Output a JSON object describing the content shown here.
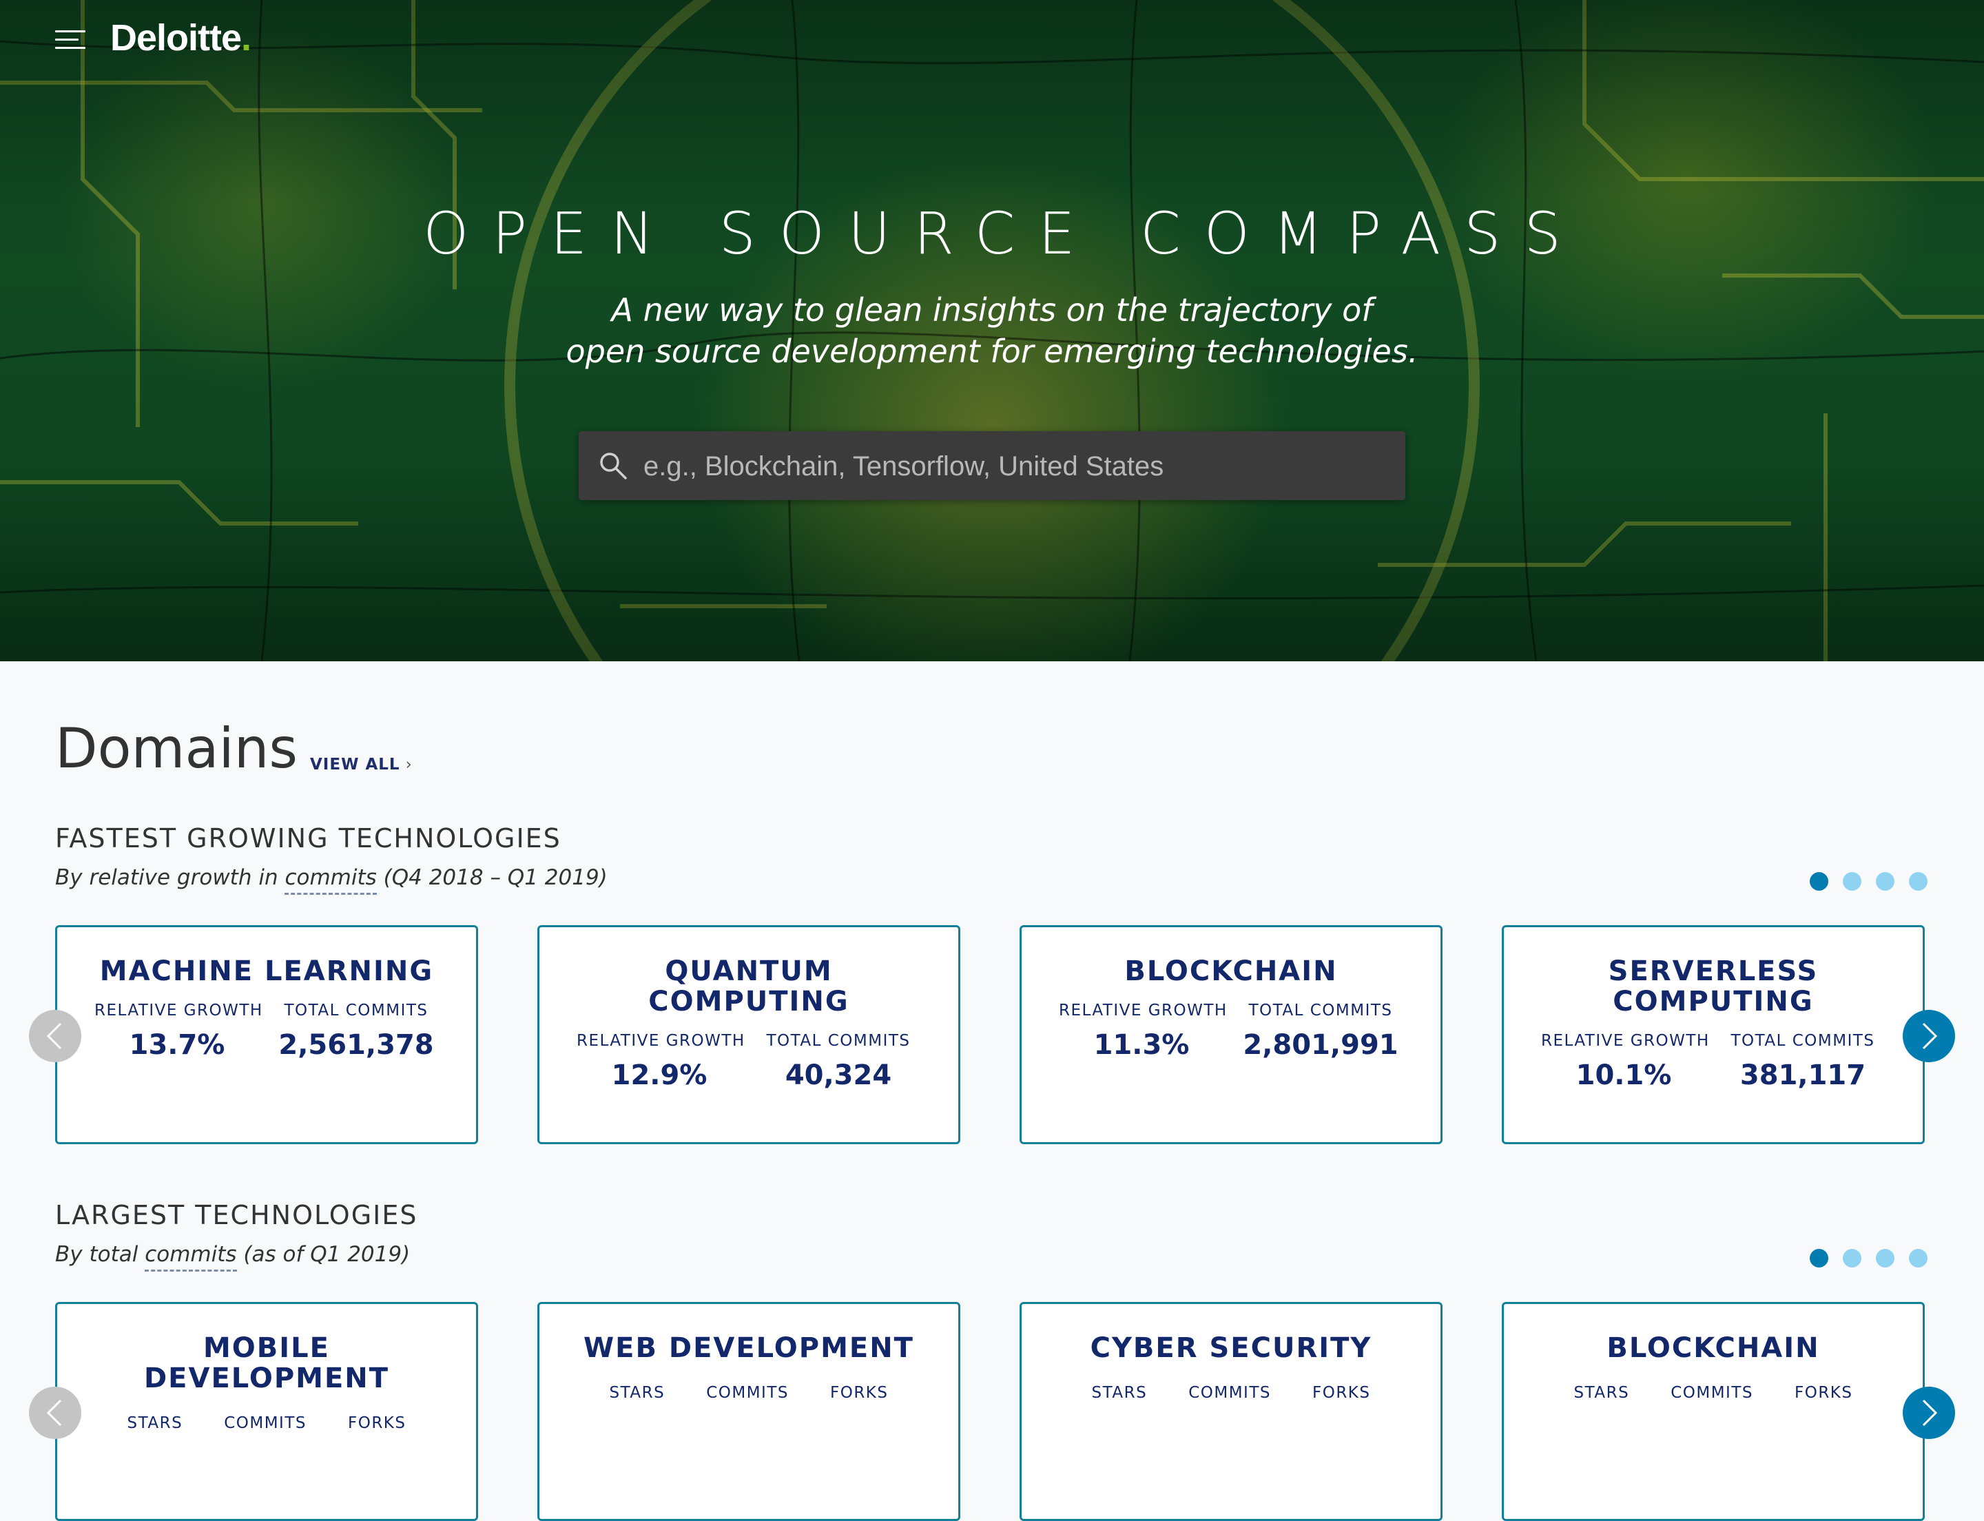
{
  "header": {
    "logo_text": "Deloitte",
    "logo_dot": ".",
    "menu_icon": "hamburger-menu-icon"
  },
  "hero": {
    "title": "OPEN SOURCE COMPASS",
    "subtitle_line1": "A new way to glean insights on the trajectory of",
    "subtitle_line2": "open source development for emerging technologies.",
    "search_placeholder": "e.g., Blockchain, Tensorflow, United States",
    "search_icon": "search-icon"
  },
  "domains": {
    "title": "Domains",
    "view_all": "VIEW ALL",
    "view_all_chevron": "›"
  },
  "fastest": {
    "title": "FASTEST GROWING TECHNOLOGIES",
    "subtitle_before": "By relative growth in ",
    "subtitle_link": "commits",
    "subtitle_after": " (Q4 2018 – Q1 2019)",
    "pages": 4,
    "active_page": 1,
    "stat_label_1": "RELATIVE GROWTH",
    "stat_label_2": "TOTAL COMMITS",
    "cards": [
      {
        "title": "MACHINE LEARNING",
        "growth": "13.7%",
        "commits": "2,561,378"
      },
      {
        "title": "QUANTUM COMPUTING",
        "growth": "12.9%",
        "commits": "40,324"
      },
      {
        "title": "BLOCKCHAIN",
        "growth": "11.3%",
        "commits": "2,801,991"
      },
      {
        "title": "SERVERLESS COMPUTING",
        "growth": "10.1%",
        "commits": "381,117"
      }
    ]
  },
  "largest": {
    "title": "LARGEST TECHNOLOGIES",
    "subtitle_before": "By total ",
    "subtitle_link": "commits",
    "subtitle_after": " (as of Q1 2019)",
    "pages": 4,
    "active_page": 1,
    "stat_label_1": "STARS",
    "stat_label_2": "COMMITS",
    "stat_label_3": "FORKS",
    "cards": [
      {
        "title": "MOBILE DEVELOPMENT"
      },
      {
        "title": "WEB DEVELOPMENT"
      },
      {
        "title": "CYBER SECURITY"
      },
      {
        "title": "BLOCKCHAIN"
      }
    ]
  },
  "colors": {
    "navy": "#13276b",
    "card_border": "#13809b",
    "dot_active": "#007cb0",
    "dot_inactive": "#8fd2f2",
    "brand_green": "#86bc25"
  }
}
